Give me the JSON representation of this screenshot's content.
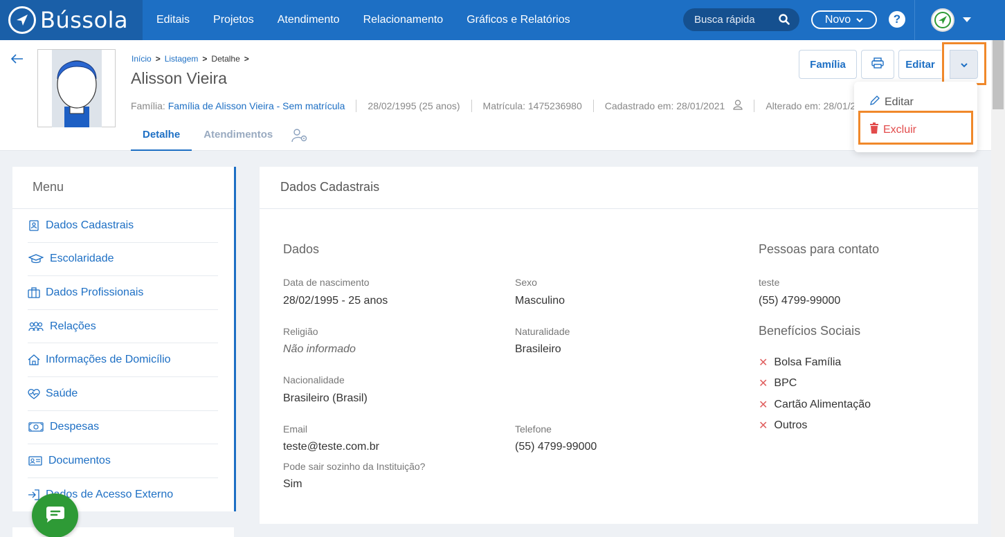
{
  "brand": {
    "name": "Bússola",
    "accent": "#1d6fc4"
  },
  "nav": {
    "items": [
      "Editais",
      "Projetos",
      "Atendimento",
      "Relacionamento",
      "Gráficos e Relatórios"
    ],
    "search_placeholder": "Busca rápida",
    "novo_label": "Novo",
    "help_label": "?"
  },
  "breadcrumb": {
    "items": [
      "Início",
      "Listagem",
      "Detalhe"
    ],
    "sep": ">"
  },
  "person": {
    "name": "Alisson Vieira",
    "family_label": "Família:",
    "family_value": "Família de Alisson Vieira - Sem matrícula",
    "birth": "28/02/1995 (25 anos)",
    "matricula": "Matrícula: 1475236980",
    "cadastrado": "Cadastrado em: 28/01/2021",
    "alterado": "Alterado em: 28/01/2021"
  },
  "tabs": [
    "Detalhe",
    "Atendimentos"
  ],
  "actions": {
    "familia": "Família",
    "editar": "Editar"
  },
  "dropdown": {
    "edit": "Editar",
    "delete": "Excluir",
    "delete_color": "#e24b4b"
  },
  "sidebar": {
    "title": "Menu",
    "items": [
      {
        "label": "Dados Cadastrais",
        "icon": "id-card-icon"
      },
      {
        "label": "Escolaridade",
        "icon": "graduation-cap-icon"
      },
      {
        "label": "Dados Profissionais",
        "icon": "briefcase-icon"
      },
      {
        "label": "Relações",
        "icon": "people-icon"
      },
      {
        "label": "Informações de Domicílio",
        "icon": "home-icon"
      },
      {
        "label": "Saúde",
        "icon": "heartbeat-icon"
      },
      {
        "label": "Despesas",
        "icon": "money-icon"
      },
      {
        "label": "Documentos",
        "icon": "document-icon"
      },
      {
        "label": "Dados de Acesso Externo",
        "icon": "login-icon"
      }
    ]
  },
  "content": {
    "title": "Dados Cadastrais",
    "dados_title": "Dados",
    "fields": {
      "birth_label": "Data de nascimento",
      "birth_value": "28/02/1995 - 25 anos",
      "sex_label": "Sexo",
      "sex_value": "Masculino",
      "religion_label": "Religião",
      "religion_value": "Não informado",
      "nat_label": "Naturalidade",
      "nat_value": "Brasileiro",
      "nationality_label": "Nacionalidade",
      "nationality_value": "Brasileiro (Brasil)",
      "email_label": "Email",
      "email_value": "teste@teste.com.br",
      "phone_label": "Telefone",
      "phone_value": "(55) 4799-99000",
      "alone_label": "Pode sair sozinho da Instituição?",
      "alone_value": "Sim"
    },
    "contacts_title": "Pessoas para contato",
    "contact_name": "teste",
    "contact_phone": "(55) 4799-99000",
    "benefits_title": "Benefícios Sociais",
    "benefits": [
      "Bolsa Família",
      "BPC",
      "Cartão Alimentação",
      "Outros"
    ]
  }
}
